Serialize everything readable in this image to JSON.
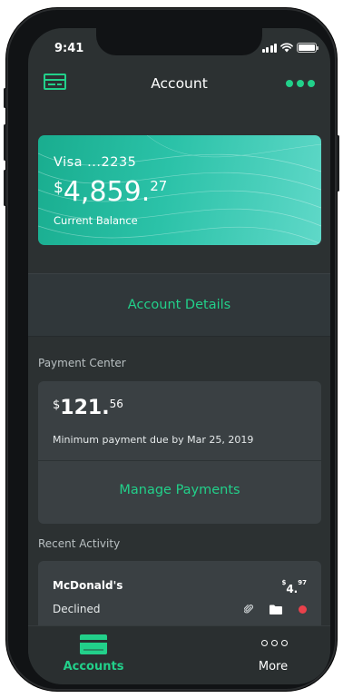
{
  "status_bar": {
    "time": "9:41"
  },
  "header": {
    "title": "Account",
    "left_icon": "credit-card-icon",
    "right_icon": "more-dots-icon"
  },
  "balance_card": {
    "card_name": "Visa ...2235",
    "currency": "$",
    "amount_whole": "4,859.",
    "amount_cents": "27",
    "label": "Current Balance"
  },
  "account_details": {
    "label": "Account Details"
  },
  "payment_center": {
    "section_label": "Payment Center",
    "currency": "$",
    "amount_whole": "121.",
    "amount_cents": "56",
    "due_text": "Minimum payment due by Mar 25, 2019",
    "manage_label": "Manage Payments"
  },
  "recent_activity": {
    "section_label": "Recent Activity",
    "items": [
      {
        "merchant": "McDonald's",
        "status": "Declined",
        "currency": "$",
        "amount_whole": "4.",
        "amount_cents": "97",
        "icons": [
          "paperclip-icon",
          "folder-icon",
          "status-dot-icon"
        ],
        "status_color": "#e9414b"
      }
    ]
  },
  "tab_bar": {
    "tabs": [
      {
        "label": "Accounts",
        "icon": "credit-card-icon",
        "active": true
      },
      {
        "label": "More",
        "icon": "more-dots-icon",
        "active": false
      }
    ]
  },
  "colors": {
    "accent": "#22d08a",
    "background": "#2c3132",
    "card_surface": "#3a4043"
  }
}
